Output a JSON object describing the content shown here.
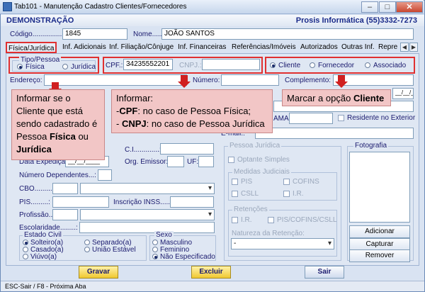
{
  "window": {
    "title": "Tab101 - Manutenção Cadastro Clientes/Fornecedores"
  },
  "header": {
    "left": "DEMONSTRAÇÃO",
    "right": "Prosis Informática (55)3332-7273"
  },
  "form": {
    "codigo_label": "Código...............",
    "codigo_value": "1845",
    "nome_label": "Nome.....:",
    "nome_value": "JOÃO SANTOS"
  },
  "tabs": [
    "Física/Jurídica",
    "Inf. Adicionais",
    "Inf. Filiação/Cônjuge",
    "Inf. Financeiras",
    "Referências/Imóveis",
    "Autorizados",
    "Outras Inf.",
    "Repre"
  ],
  "tipo_pessoa": {
    "title": "Tipo/Pessoa",
    "fisica": "Física",
    "juridica": "Jurídica"
  },
  "doc": {
    "cpf_label": "CPF.:",
    "cpf_value": "34235552201",
    "cnpj_label": "CNPJ.:"
  },
  "classificacao": {
    "cliente": "Cliente",
    "fornecedor": "Fornecedor",
    "associado": "Associado"
  },
  "endereco": {
    "endereco_label": "Endereço:",
    "numero_label": "Número:",
    "complemento_label": "Complemento:"
  },
  "callouts": {
    "c1_pre": "Informar se o Cliente que está sendo cadastrado é Pessoa ",
    "c1_b1": "Física",
    "c1_mid": " ou ",
    "c1_b2": "Jurídica",
    "c2_l1": "Informar:",
    "c2_l2_b": "CPF",
    "c2_l2": ": no caso de Pessoa Física;",
    "c2_l3_b": "CNPJ",
    "c2_l3": ": no caso de Pessoa Jurídica",
    "c3_pre": "Marcar a opção ",
    "c3_b": "Cliente"
  },
  "partial": {
    "ama": "AMA:",
    "residente": "Residente no Exterior",
    "email": "E-mail.:",
    "date_mask": "__/__/__"
  },
  "pf": {
    "ci_label": "C.I.............:",
    "data_exp_label": "Data Expedição..:",
    "date_mask": "__/__/____",
    "orgao_label": "Org. Emissor:",
    "uf_label": "UF:",
    "dependentes_label": "Número Dependentes...:",
    "cbo_label": "CBO.........:",
    "pis_label": "PIS.........:",
    "inscricao_label": "Inscrição INSS.....:",
    "profissao_label": "Profissão..:",
    "escolaridade_label": "Escolaridade........:"
  },
  "estado_civil": {
    "title": "Estado Civil",
    "solteiro": "Solteiro(a)",
    "casado": "Casado(a)",
    "viuvo": "Viúvo(a)",
    "separado": "Separado(a)",
    "uniao": "União Estável"
  },
  "sexo": {
    "title": "Sexo",
    "masculino": "Masculino",
    "feminino": "Feminino",
    "nao_espec": "Não Especificado"
  },
  "pj": {
    "title": "Pessoa Jurídica",
    "optante": "Optante Simples",
    "medidas_title": "Medidas Judiciais",
    "pis": "PIS",
    "cofins": "COFINS",
    "csll": "CSLL",
    "ir": "I.R.",
    "retencoes_title": "Retenções",
    "ret_ir": "I.R.",
    "ret_pis": "PIS/COFINS/CSLL",
    "natureza_label": "Natureza da Retenção:",
    "natureza_value": "-"
  },
  "foto": {
    "title": "Fotografia",
    "adicionar": "Adicionar",
    "capturar": "Capturar",
    "remover": "Remover"
  },
  "buttons": {
    "gravar": "Gravar",
    "excluir": "Excluir",
    "sair": "Sair"
  },
  "status": {
    "text": "ESC-Sair / F8 - Próxima Aba"
  }
}
